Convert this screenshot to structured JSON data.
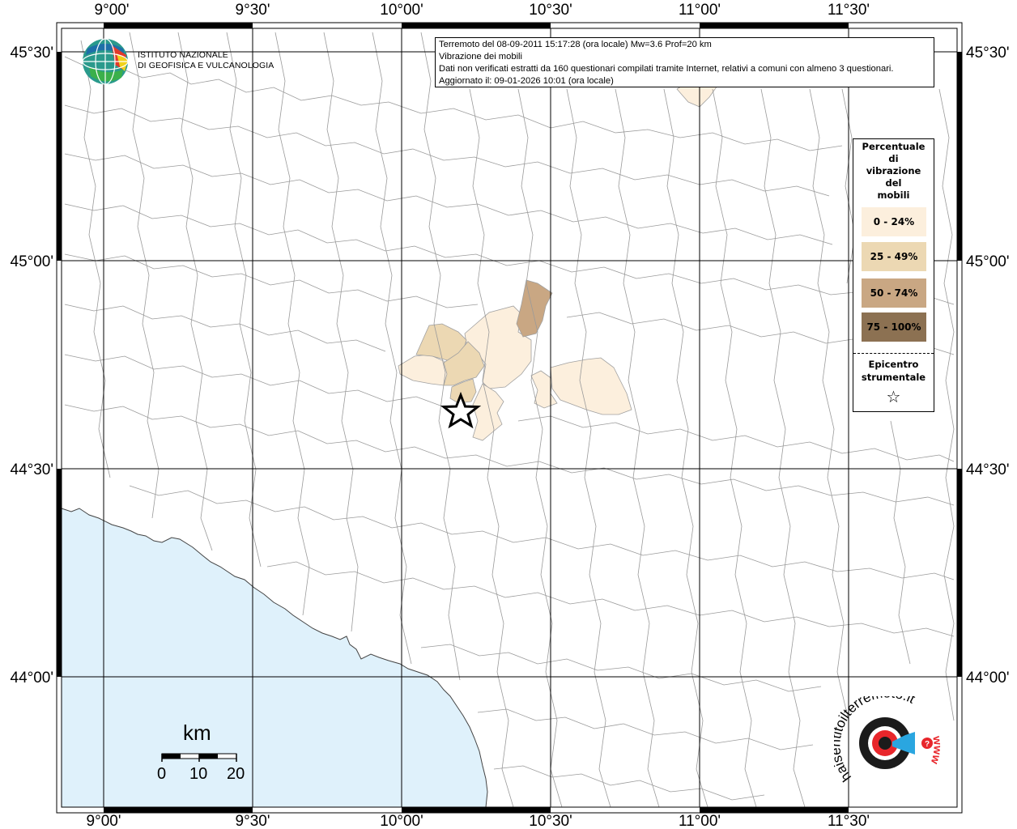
{
  "lon_labels": [
    "9°00'",
    "9°30'",
    "10°00'",
    "10°30'",
    "11°00'",
    "11°30'"
  ],
  "lat_labels": [
    "45°30'",
    "45°00'",
    "44°30'",
    "44°00'"
  ],
  "info": {
    "line1": "Terremoto del 08-09-2011 15:17:28 (ora locale) Mw=3.6 Prof=20 km",
    "line2": "Vibrazione dei mobili",
    "line3": "Dati non verificati estratti da 160 questionari compilati tramite Internet, relativi a comuni con almeno 3 questionari.",
    "line4": "Aggiornato il: 09-01-2026 10:01 (ora locale)"
  },
  "logo": {
    "line1": "ISTITUTO NAZIONALE",
    "line2": "DI GEOFISICA E VULCANOLOGIA"
  },
  "legend": {
    "title": [
      "Percentuale",
      "di",
      "vibrazione",
      "del",
      "mobili"
    ],
    "classes": [
      {
        "label": "0 - 24%",
        "color": "#fcefdd"
      },
      {
        "label": "25 - 49%",
        "color": "#ecd8b3"
      },
      {
        "label": "50 - 74%",
        "color": "#c9a783"
      },
      {
        "label": "75 - 100%",
        "color": "#8c7152"
      }
    ],
    "epicenter_title": [
      "Epicentro",
      "strumentale"
    ],
    "epicenter_symbol": "☆"
  },
  "scale": {
    "unit": "km",
    "ticks": [
      "0",
      "10",
      "20"
    ]
  },
  "hst_logo": {
    "text": "haisentitoilterremoto.it",
    "web": "www"
  },
  "colors": {
    "sea": "#dff1fb",
    "land": "#ffffff",
    "grid": "#000000",
    "boundary": "#9a9a9a"
  }
}
